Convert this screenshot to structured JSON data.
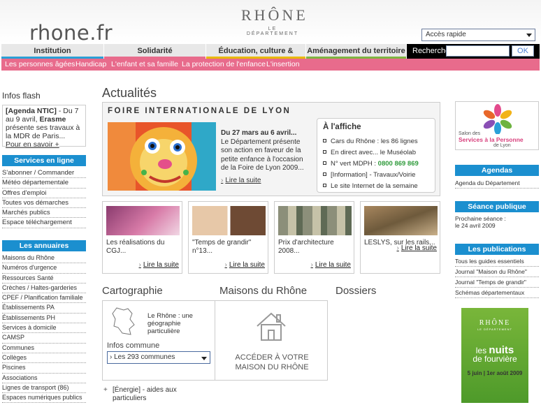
{
  "header": {
    "site_name": "rhone.fr",
    "logo_line1": "RHÔNE",
    "logo_line2": "LE DÉPARTEMENT",
    "quick_access": "Accès rapide"
  },
  "nav": {
    "tabs": [
      {
        "label": "Institution",
        "color": "#2a9fd6"
      },
      {
        "label": "Solidarité",
        "color": "#e86b8c"
      },
      {
        "label": "Éducation, culture & loisirs",
        "color": "#e9b800"
      },
      {
        "label": "Aménagement du territoire",
        "color": "#7fb441"
      }
    ],
    "search_label": "Recherche",
    "search_value": "",
    "ok_label": "OK"
  },
  "subnav": [
    "Les personnes âgées",
    "Handicap",
    "L'enfant et sa famille",
    "La protection de l'enfance",
    "L'insertion"
  ],
  "left": {
    "flash_title": "Infos flash",
    "flash_text_bold": "[Agenda NTIC]",
    "flash_text1": " - Du 7 au 9 avril, ",
    "flash_text_bold2": "Erasme",
    "flash_text2": " présente ses travaux à la MDR de Paris...",
    "flash_more": "Pour en savoir +",
    "services_title": "Services en ligne",
    "services": [
      "S'abonner / Commander",
      "Météo départementale",
      "Offres d'emploi",
      "Toutes vos démarches",
      "Marchés publics",
      "Espace téléchargement"
    ],
    "annuaires_title": "Les annuaires",
    "annuaires": [
      "Maisons du Rhône",
      "Numéros d'urgence",
      "Ressources Santé",
      "Crèches / Haltes-garderies",
      "CPEF / Planification familiale",
      "Établissements PA",
      "Établissements PH",
      "Services à domicile",
      "CAMSP",
      "Communes",
      "Collèges",
      "Piscines",
      "Associations",
      "Lignes de transport (86)",
      "Espaces numériques publics"
    ]
  },
  "main": {
    "actualites_title": "Actualités",
    "feature_title": "FOIRE INTERNATIONALE DE LYON",
    "feature_date": "Du 27 mars au 6 avril...",
    "feature_text": "Le Département présente son action en faveur de la petite enfance à l'occasion de la Foire de Lyon 2009...",
    "feature_link": "Lire la suite",
    "affiche_title": "À l'affiche",
    "affiche_items": [
      "Cars du Rhône : les 86 lignes",
      "En direct avec... le Muséolab",
      "N° vert MDPH : ",
      "[Information] - Travaux/Voirie",
      "Le site Internet de la semaine"
    ],
    "affiche_phone": "0800 869 869",
    "thumbs": [
      {
        "caption": "Les réalisations du CGJ...",
        "link": "Lire la suite"
      },
      {
        "caption": "\"Temps de grandir\" n°13...",
        "link": "Lire la suite"
      },
      {
        "caption": "Prix d'architecture 2008...",
        "link": "Lire la suite"
      },
      {
        "caption": "LESLYS, sur les rails...",
        "link": "Lire la suite"
      }
    ],
    "cartographie_title": "Cartographie",
    "maisons_title": "Maisons du Rhône",
    "dossiers_title": "Dossiers",
    "carto_text": "Le Rhône : une géographie particulière",
    "infos_commune": "Infos commune",
    "commune_select": "› Les 293 communes",
    "maison_text": "ACCÉDER À VOTRE MAISON DU RHÔNE",
    "energie_bold": "[Énergie]",
    "energie_text": " - aides aux particuliers"
  },
  "right": {
    "salon_line1": "Salon des",
    "salon_line2": "Services à la Personne",
    "salon_line3": "de Lyon",
    "agendas_title": "Agendas",
    "agendas": [
      "Agenda du Département"
    ],
    "seance_title": "Séance publique",
    "seance_text1": "Prochaine séance :",
    "seance_text2": "le 24 avril 2009",
    "publications_title": "Les publications",
    "publications": [
      "Tous les guides essentiels",
      "Journal \"Maison du Rhône\"",
      "Journal \"Temps de grandir\"",
      "Schémas départementaux"
    ],
    "banner_logo": "RHÔNE",
    "banner_logo2": "LE DÉPARTEMENT",
    "banner_les": "les",
    "banner_nuits": "nuits",
    "banner_fourviere": "de fourvière",
    "banner_date": "5 juin | 1er août 2009"
  }
}
